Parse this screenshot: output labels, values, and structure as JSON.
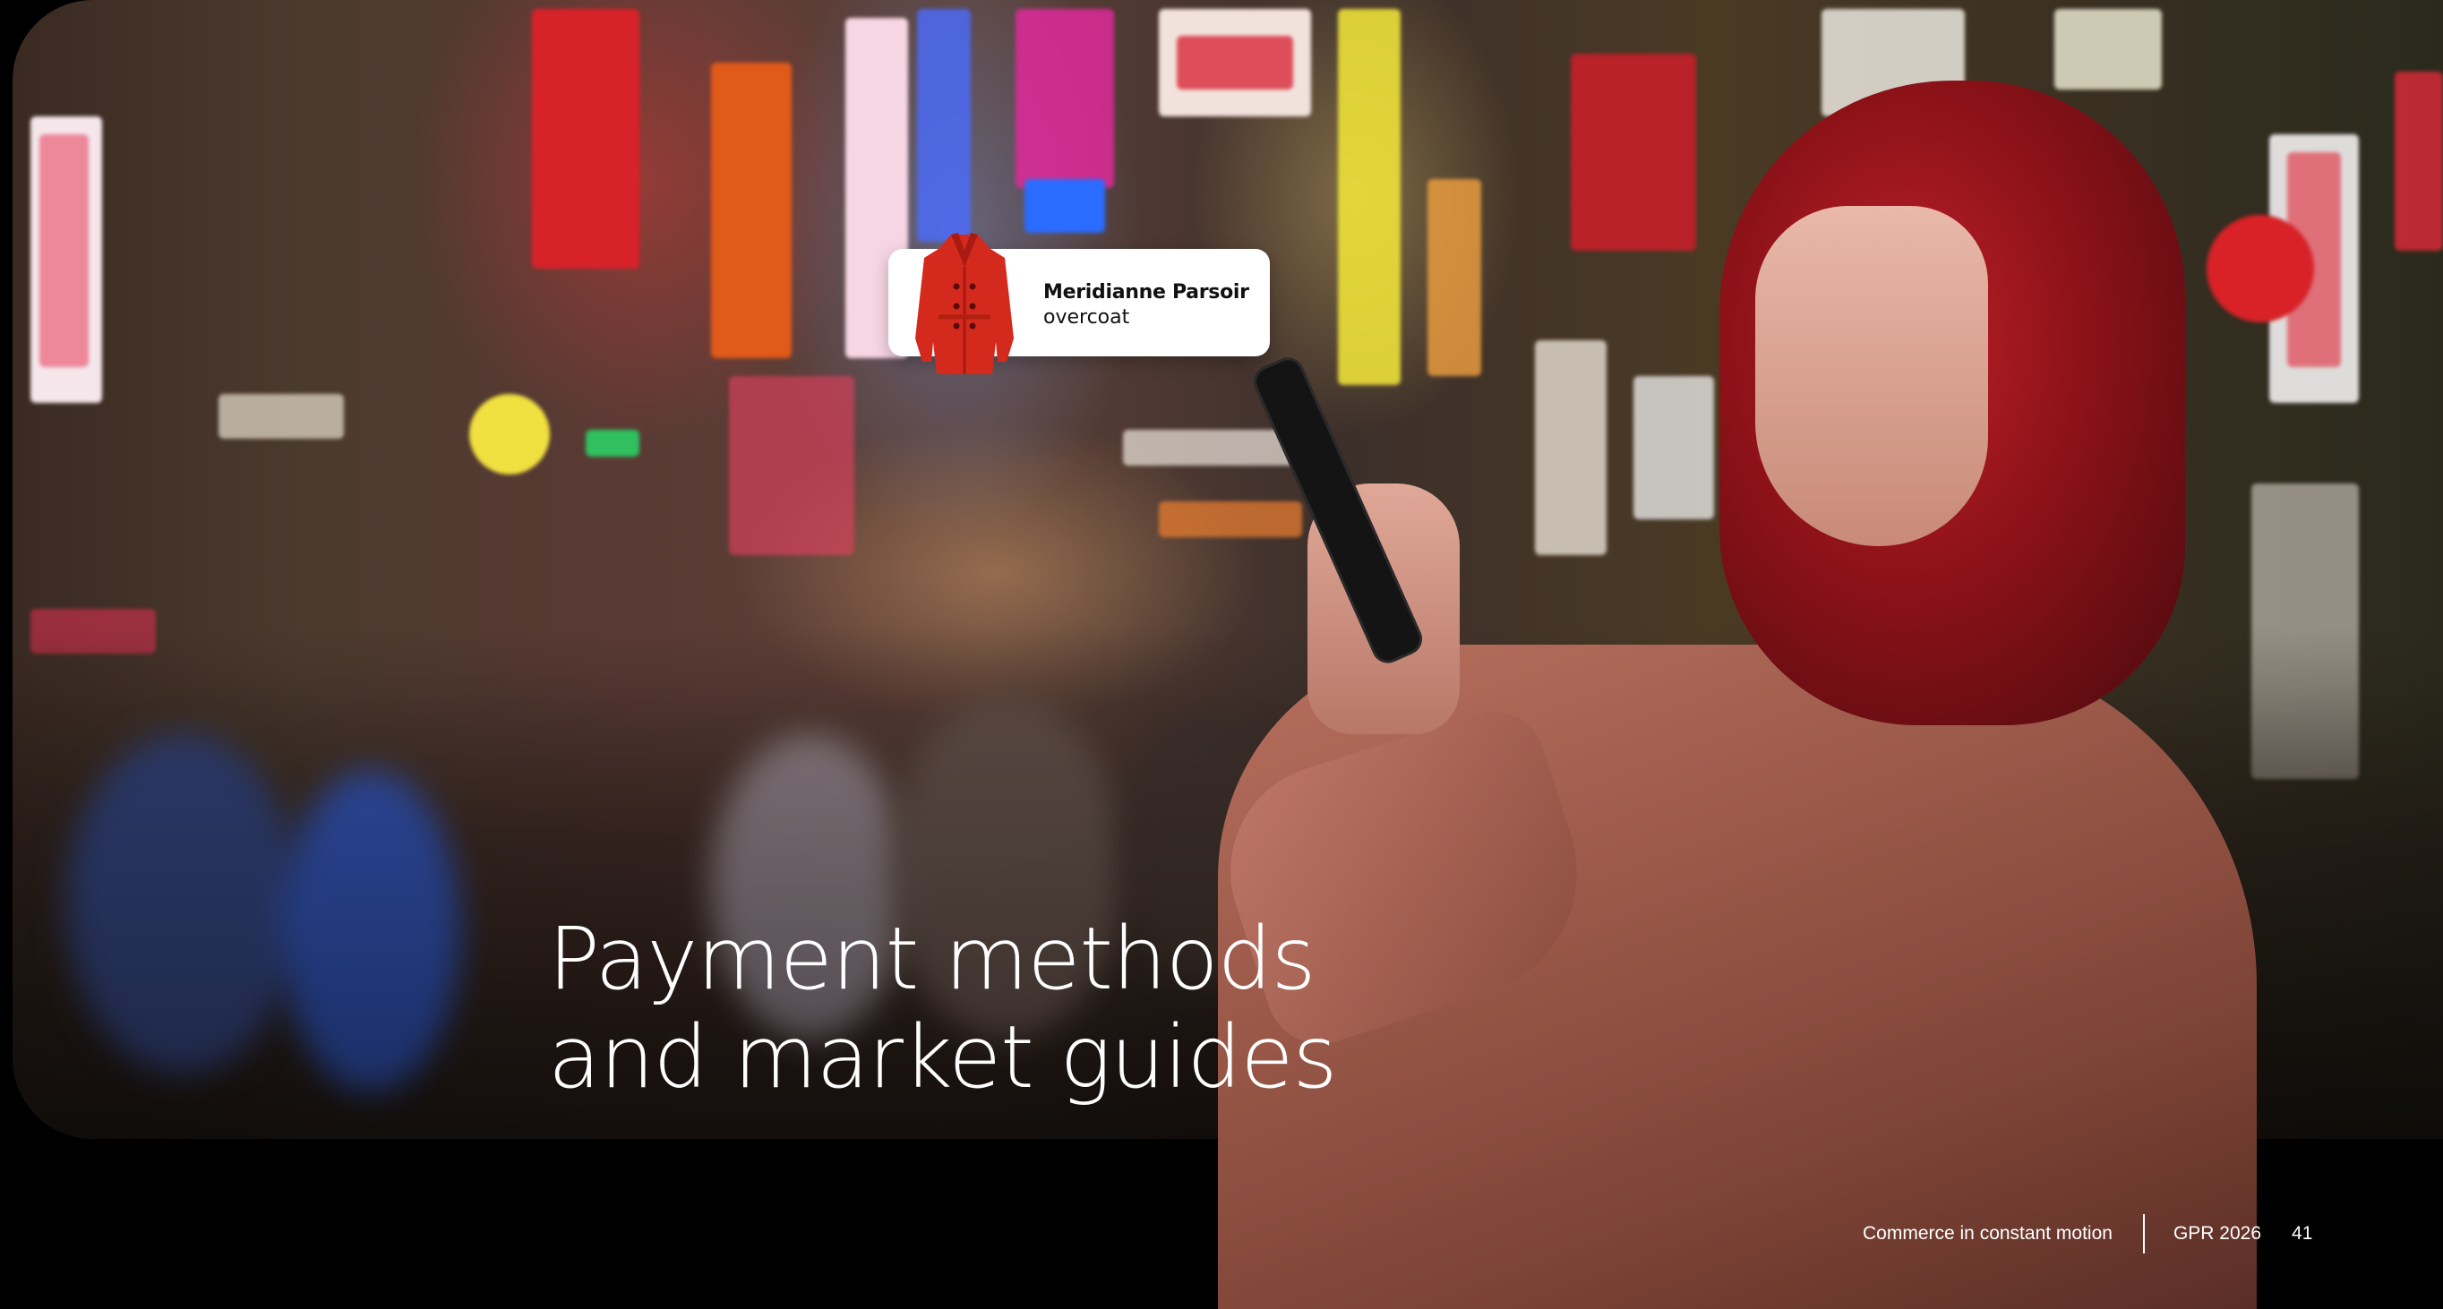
{
  "product_tag": {
    "brand": "Meridianne Parsoir",
    "item": "overcoat",
    "icon": "red-coat-icon"
  },
  "headline": {
    "line1": "Payment methods",
    "line2": "and market guides"
  },
  "footer": {
    "caption": "Commerce in constant motion",
    "report": "GPR 2026",
    "page_number": "41"
  },
  "colors": {
    "page_background": "#000000",
    "headline_text": "#ffffff",
    "card_background": "#ffffff",
    "coat_red": "#d42a1e"
  }
}
